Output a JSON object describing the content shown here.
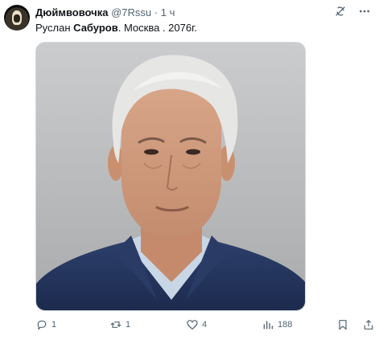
{
  "tweet": {
    "author_name": "Дюймвовочка",
    "handle": "@7Rssu",
    "separator": "·",
    "time": "1 ч",
    "text_prefix": "Руслан ",
    "text_bold": "Сабуров",
    "text_suffix": ". Москва . 2076г."
  },
  "actions": {
    "replies": "1",
    "reposts": "1",
    "likes": "4",
    "views": "188"
  },
  "icons": {
    "top": [
      "grok-icon",
      "more-icon"
    ],
    "bottom": [
      "reply-icon",
      "repost-icon",
      "like-icon",
      "views-icon",
      "bookmark-icon",
      "share-icon"
    ]
  },
  "colors": {
    "text": "#0f1419",
    "muted": "#536471",
    "border": "#cfd9de"
  }
}
